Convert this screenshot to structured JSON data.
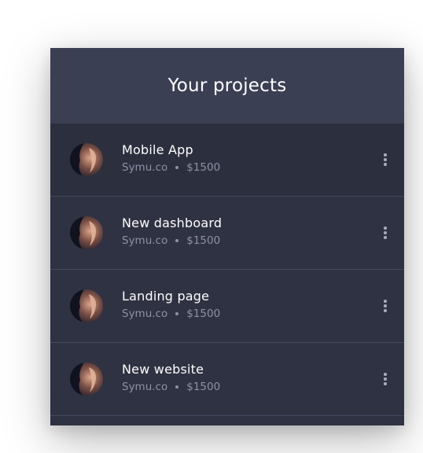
{
  "header": {
    "title": "Your projects"
  },
  "projects": [
    {
      "title": "Mobile App",
      "client": "Symu.co",
      "price": "$1500"
    },
    {
      "title": "New dashboard",
      "client": "Symu.co",
      "price": "$1500"
    },
    {
      "title": "Landing page",
      "client": "Symu.co",
      "price": "$1500"
    },
    {
      "title": "New website",
      "client": "Symu.co",
      "price": "$1500"
    }
  ],
  "colors": {
    "header_bg": "#3b3f54",
    "panel_bg": "#2f3242",
    "title_text": "#ffffff",
    "meta_text": "#8e92a7"
  },
  "icons": {
    "avatar": "avatar-photo",
    "more": "more-vertical-icon"
  }
}
